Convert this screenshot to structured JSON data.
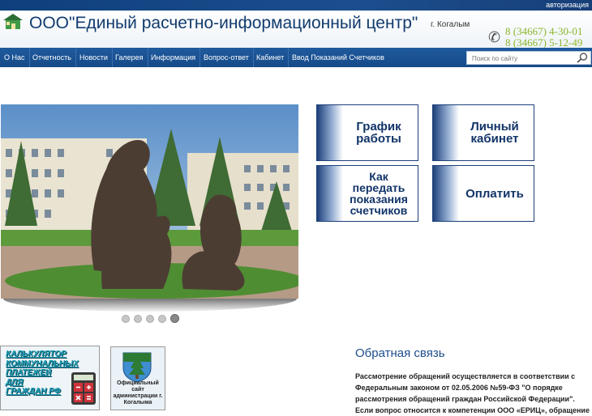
{
  "topbar": {
    "auth_link": "авторизация"
  },
  "header": {
    "title": "ООО\"Единый расчетно-информационный центр\"",
    "city": "г. Когалым",
    "phones": [
      "8 (34667) 4-30-01",
      "8 (34667) 5-12-49"
    ]
  },
  "nav": {
    "items": [
      "О Нас",
      "Отчетность",
      "Новости",
      "Галерея",
      "Информация",
      "Вопрос-ответ",
      "Кабинет",
      "Ввод Показаний Счетчиков"
    ]
  },
  "search": {
    "placeholder": "Поиск по сайту"
  },
  "slider": {
    "slide_count": 5,
    "active_index": 4
  },
  "tiles": [
    "График\nработы",
    "Личный\nкабинет",
    "Как\nпередать\nпоказания\nсчетчиков",
    "Оплатить"
  ],
  "banners": {
    "calculator": "КАЛЬКУЛЯТОР\nКОММУНАЛЬНЫХ\nПЛАТЕЖЕЙ\nДЛЯ\nГРАЖДАН РФ",
    "admin_site": "Официальный\nсайт\nадминистрации г.\nКогалыма"
  },
  "feedback": {
    "title": "Обратная связь",
    "text": "Рассмотрение обращений осуществляется в соответствии с Федеральным законом от 02.05.2006 №59-ФЗ \"О порядке рассмотрения обращений граждан Российской Федерации\". Если вопрос относится к компетенции ООО «ЕРИЦ», обращение"
  },
  "colors": {
    "brand": "#123c6e",
    "nav": "#1a5294",
    "phone": "#8cb52b",
    "tile_text": "#123468"
  }
}
